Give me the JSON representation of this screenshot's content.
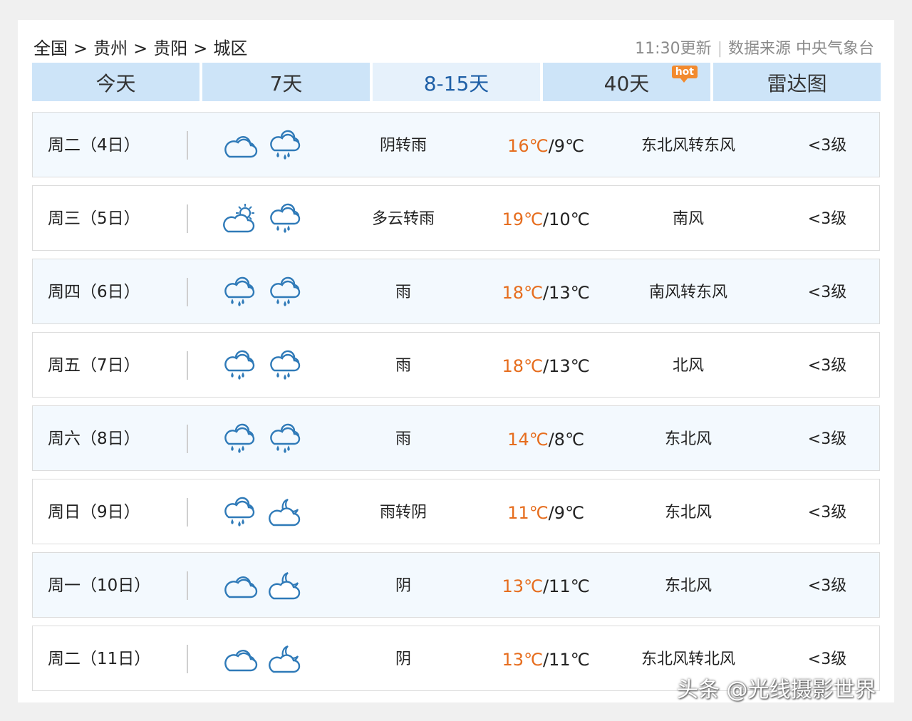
{
  "breadcrumb": {
    "items": [
      "全国",
      "贵州",
      "贵阳",
      "城区"
    ],
    "separator": ">"
  },
  "meta": {
    "update_time": "11:30更新",
    "source": "数据来源 中央气象台"
  },
  "tabs": [
    {
      "label": "今天",
      "active": false
    },
    {
      "label": "7天",
      "active": false
    },
    {
      "label": "8-15天",
      "active": true
    },
    {
      "label": "40天",
      "active": false,
      "badge": "hot"
    },
    {
      "label": "雷达图",
      "active": false
    }
  ],
  "temp_unit": "℃",
  "forecast": [
    {
      "day": "周二（4日）",
      "icon_day": "cloud-icon",
      "icon_night": "rain-icon",
      "desc": "阴转雨",
      "high": "16℃",
      "low": "9℃",
      "wind": "东北风转东风",
      "level": "<3级"
    },
    {
      "day": "周三（5日）",
      "icon_day": "partly-cloudy-sun-icon",
      "icon_night": "rain-icon",
      "desc": "多云转雨",
      "high": "19℃",
      "low": "10℃",
      "wind": "南风",
      "level": "<3级"
    },
    {
      "day": "周四（6日）",
      "icon_day": "rain-icon",
      "icon_night": "rain-icon",
      "desc": "雨",
      "high": "18℃",
      "low": "13℃",
      "wind": "南风转东风",
      "level": "<3级"
    },
    {
      "day": "周五（7日）",
      "icon_day": "rain-icon",
      "icon_night": "rain-icon",
      "desc": "雨",
      "high": "18℃",
      "low": "13℃",
      "wind": "北风",
      "level": "<3级"
    },
    {
      "day": "周六（8日）",
      "icon_day": "rain-icon",
      "icon_night": "rain-icon",
      "desc": "雨",
      "high": "14℃",
      "low": "8℃",
      "wind": "东北风",
      "level": "<3级"
    },
    {
      "day": "周日（9日）",
      "icon_day": "rain-icon",
      "icon_night": "partly-cloudy-moon-icon",
      "desc": "雨转阴",
      "high": "11℃",
      "low": "9℃",
      "wind": "东北风",
      "level": "<3级"
    },
    {
      "day": "周一（10日）",
      "icon_day": "cloud-icon",
      "icon_night": "partly-cloudy-moon-icon",
      "desc": "阴",
      "high": "13℃",
      "low": "11℃",
      "wind": "东北风",
      "level": "<3级"
    },
    {
      "day": "周二（11日）",
      "icon_day": "cloud-icon",
      "icon_night": "partly-cloudy-moon-icon",
      "desc": "阴",
      "high": "13℃",
      "low": "11℃",
      "wind": "东北风转北风",
      "level": "<3级"
    }
  ],
  "colors": {
    "accent": "#1e5fa6",
    "tab_bg": "#cde4f8",
    "high_temp": "#e66d1e",
    "icon": "#2f7ab8",
    "hot_badge": "#f28a2e"
  },
  "watermark": "头条 @光线摄影世界"
}
